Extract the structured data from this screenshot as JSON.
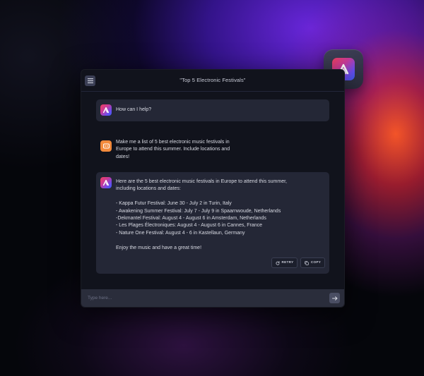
{
  "window": {
    "title": "\"Top 5 Electronic Festivals\""
  },
  "icons": {
    "menu": "hamburger-menu-icon",
    "logo": "app-logo-icon",
    "user": "user-avatar-icon",
    "retry": "refresh-icon",
    "copy": "copy-icon",
    "send": "arrow-right-icon"
  },
  "messages": [
    {
      "role": "assistant",
      "lines": [
        "How can I help?"
      ]
    },
    {
      "role": "user",
      "lines": [
        "Make me a list of 5 best electronic music festivals in",
        "Europe to attend this summer. Include locations and",
        "dates!"
      ]
    },
    {
      "role": "assistant",
      "intro": [
        "Here are the 5 best electronic music festivals in Europe to attend this summer,",
        "including locations and dates:"
      ],
      "list": [
        "- Kappa Futur Festival: June 30 - July 2 in Turin, Italy",
        "- Awakening Summer Festival: July 7 - July 9 in Spaarnwoude, Netherlands",
        "-Dekmantel Festival: August 4 - August 6 in Amsterdam, Netherlands",
        "- Les Plages Électroniques: August 4 - August 6 in Cannes, France",
        "- Nature One Festival: August 4 - 6 in Kastellaun, Germany"
      ],
      "outro": "Enjoy the music and have a great time!",
      "retry_label": "RETRY",
      "copy_label": "COPY"
    }
  ],
  "input": {
    "placeholder": "Type here..."
  },
  "colors": {
    "accent_user": "#f28a3c",
    "window_bg": "#11131c",
    "bubble_bg": "#242736"
  }
}
